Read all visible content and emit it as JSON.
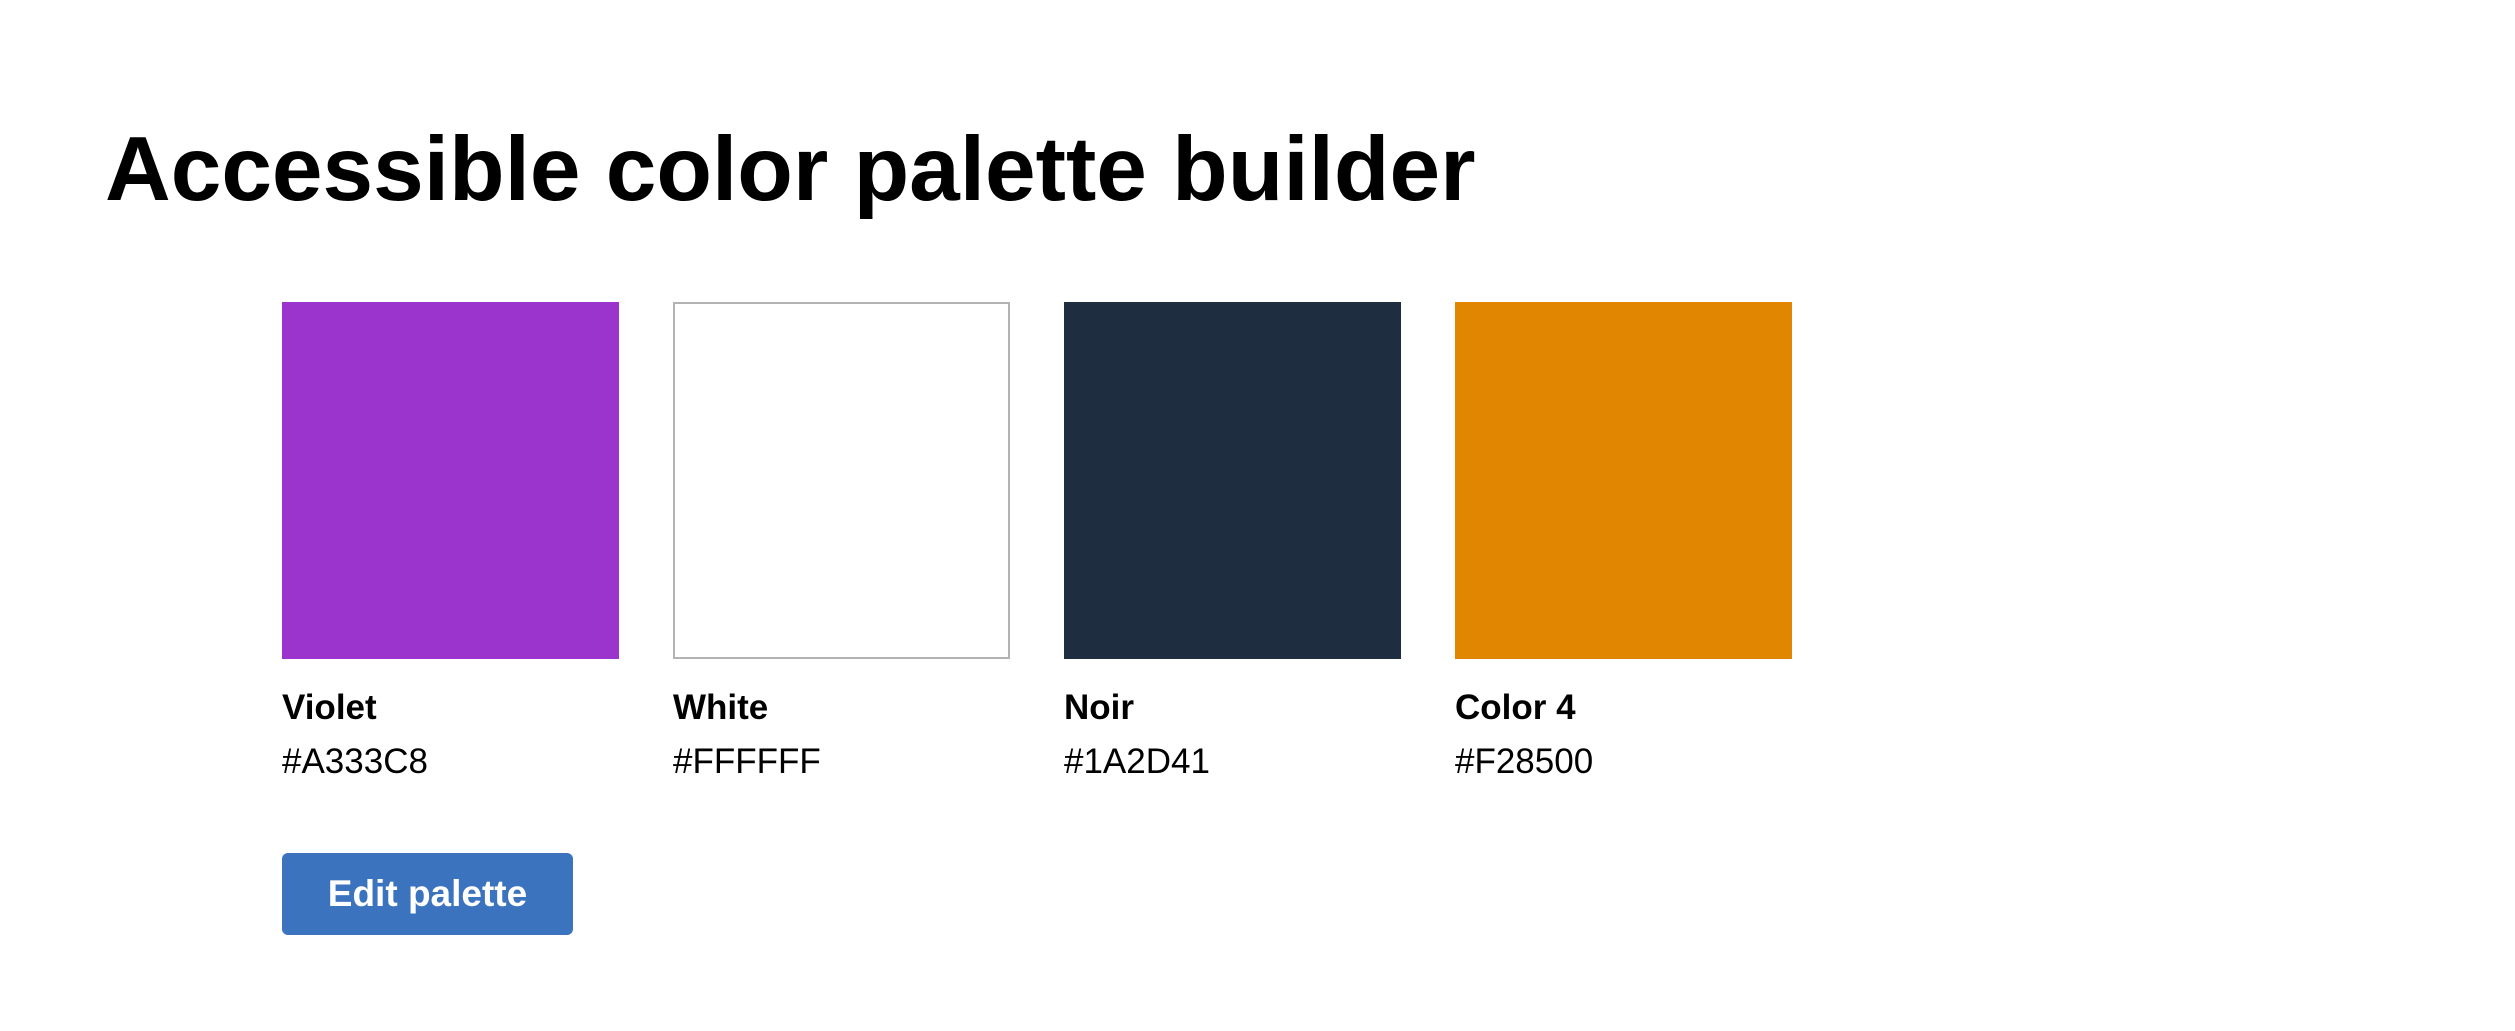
{
  "page": {
    "title": "Accessible color palette builder"
  },
  "palette": [
    {
      "name": "Violet",
      "hex": "#A333C8",
      "swatch_color": "#9B34CC",
      "outlined": false
    },
    {
      "name": "White",
      "hex": "#FFFFFF",
      "swatch_color": "#FFFFFF",
      "outlined": true
    },
    {
      "name": "Noir",
      "hex": "#1A2D41",
      "swatch_color": "#1F2D40",
      "outlined": false
    },
    {
      "name": "Color 4",
      "hex": "#F28500",
      "swatch_color": "#E18600",
      "outlined": false
    }
  ],
  "actions": {
    "edit_label": "Edit palette",
    "edit_color": "#3B73BF"
  }
}
